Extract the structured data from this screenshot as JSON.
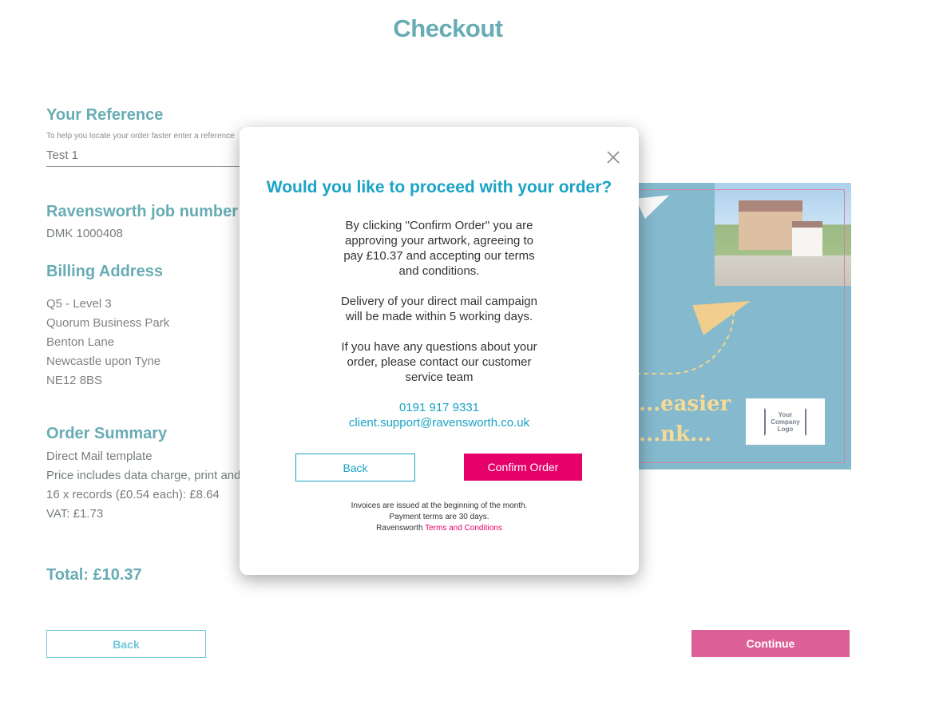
{
  "page": {
    "title": "Checkout"
  },
  "reference": {
    "heading": "Your Reference",
    "hint": "To help you locate your order faster enter a reference",
    "value": "Test 1"
  },
  "job": {
    "heading": "Ravensworth job number",
    "value": "DMK 1000408"
  },
  "billing": {
    "heading": "Billing Address",
    "lines": [
      "Q5 - Level 3",
      "Quorum Business Park",
      "Benton Lane",
      "Newcastle upon Tyne",
      "NE12 8BS"
    ]
  },
  "summary": {
    "heading": "Order Summary",
    "lines": [
      "Direct Mail template",
      "Price includes data charge, print and postage",
      "16 x records (£0.54 each): £8.64",
      "VAT: £1.73"
    ],
    "total": "Total: £10.37"
  },
  "buttons": {
    "back": "Back",
    "continue": "Continue"
  },
  "artwork": {
    "headline_line1": "...easier",
    "headline_line2": "...nk...",
    "logo_line1": "Your",
    "logo_line2": "Company",
    "logo_line3": "Logo"
  },
  "modal": {
    "title": "Would you like to proceed with your order?",
    "para1": [
      "By clicking \"Confirm Order\" you are",
      "approving your artwork, agreeing to",
      "pay £10.37 and accepting our terms",
      "and conditions."
    ],
    "para2": [
      "Delivery of your direct mail campaign",
      "will be made within 5 working days."
    ],
    "para3": [
      "If you have any questions about your",
      "order, please contact our customer",
      "service team"
    ],
    "phone": "0191 917 9331",
    "email": "client.support@ravensworth.co.uk",
    "back_label": "Back",
    "confirm_label": "Confirm Order",
    "fine1": "Invoices are issued at the beginning of the month.",
    "fine2": "Payment terms are 30 days.",
    "fine3_prefix": "Ravensworth",
    "fine3_link": "Terms and Conditions"
  },
  "colors": {
    "accent_teal": "#0a7a86",
    "link_blue": "#1aa3c4",
    "brand_pink": "#e5006a"
  }
}
